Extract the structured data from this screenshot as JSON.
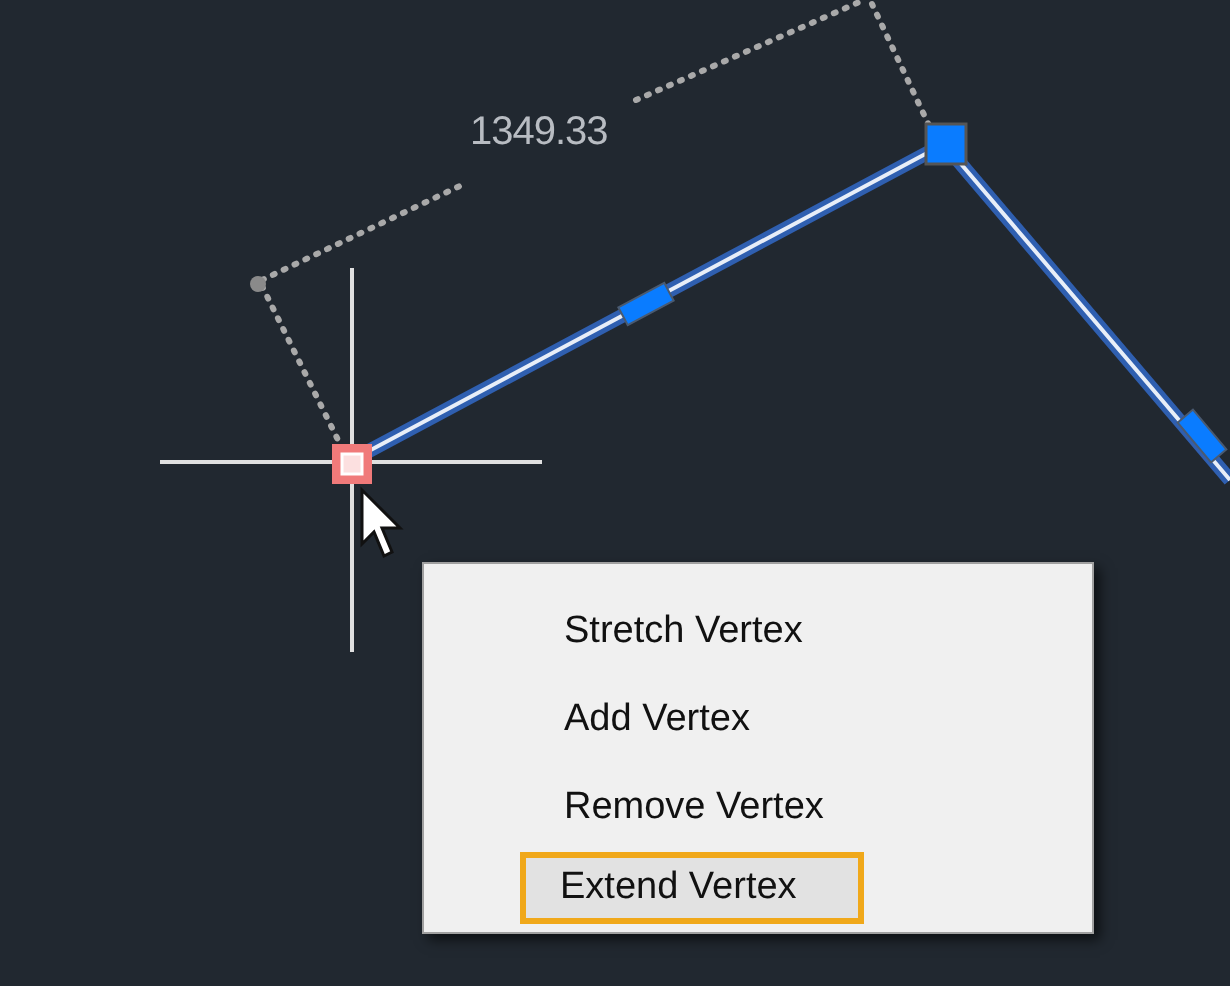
{
  "dimension": {
    "value": "1349.33"
  },
  "context_menu": {
    "items": [
      {
        "label": "Stretch Vertex",
        "selected": false
      },
      {
        "label": "Add Vertex",
        "selected": false
      },
      {
        "label": "Remove Vertex",
        "selected": false
      },
      {
        "label": "Extend Vertex",
        "selected": true
      }
    ]
  }
}
